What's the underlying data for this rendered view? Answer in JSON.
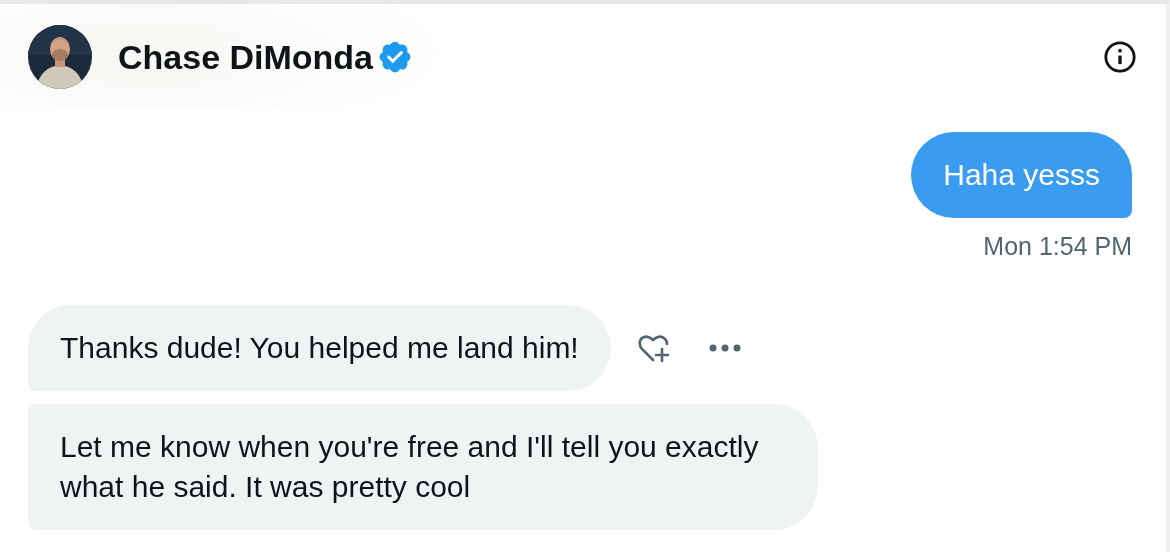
{
  "header": {
    "name": "Chase DiMonda",
    "verified": true
  },
  "messages": [
    {
      "kind": "sent",
      "text": "Haha yesss",
      "time": "Mon 1:54 PM"
    },
    {
      "kind": "received",
      "text": "Thanks dude! You helped me land him!",
      "actions": true
    },
    {
      "kind": "received",
      "text": "Let me know when you're free and I'll tell you exactly what he said. It was pretty cool",
      "actions": false
    }
  ]
}
